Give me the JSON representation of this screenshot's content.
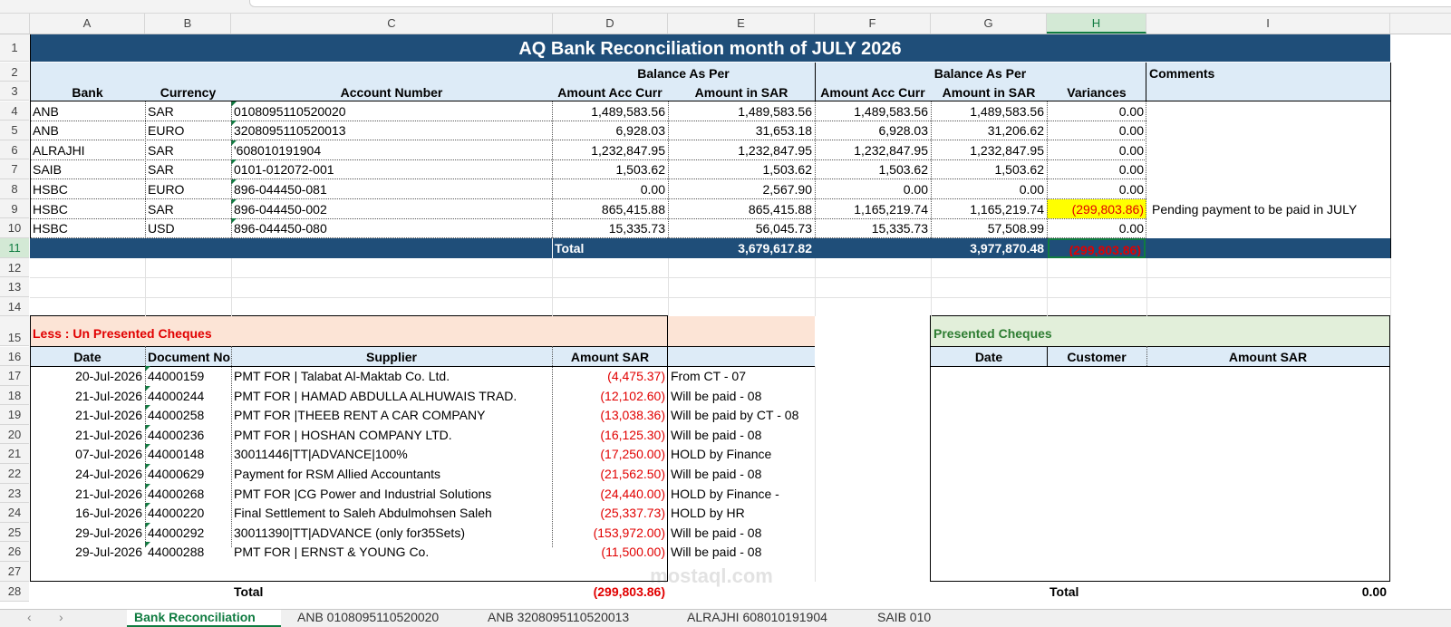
{
  "columns": [
    "A",
    "B",
    "C",
    "D",
    "E",
    "F",
    "G",
    "H",
    "I"
  ],
  "selected_column": "H",
  "rows": [
    "1",
    "2",
    "3",
    "4",
    "5",
    "6",
    "7",
    "8",
    "9",
    "10",
    "11",
    "12",
    "13",
    "14",
    "15",
    "16",
    "17",
    "18",
    "19",
    "20",
    "21",
    "22",
    "23",
    "24",
    "25",
    "26",
    "27",
    "28"
  ],
  "selected_row": "11",
  "title": "AQ Bank Reconciliation month of JULY 2026",
  "headers": {
    "balance_as_per_1": "Balance As Per",
    "balance_as_per_2": "Balance As Per",
    "comments": "Comments",
    "bank": "Bank",
    "currency": "Currency",
    "account_number": "Account Number",
    "amount_acc_curr_1": "Amount Acc Curr",
    "amount_in_sar_1": "Amount in SAR",
    "amount_acc_curr_2": "Amount Acc Curr",
    "amount_in_sar_2": "Amount in SAR",
    "variances": "Variances"
  },
  "bank_rows": [
    {
      "bank": "ANB",
      "currency": "SAR",
      "account": "0108095110520020",
      "d": "1,489,583.56",
      "e": "1,489,583.56",
      "f": "1,489,583.56",
      "g": "1,489,583.56",
      "h": "0.00",
      "comment": ""
    },
    {
      "bank": "ANB",
      "currency": "EURO",
      "account": "3208095110520013",
      "d": "6,928.03",
      "e": "31,653.18",
      "f": "6,928.03",
      "g": "31,206.62",
      "h": "0.00",
      "comment": ""
    },
    {
      "bank": "ALRAJHI",
      "currency": "SAR",
      "account": "'608010191904",
      "d": "1,232,847.95",
      "e": "1,232,847.95",
      "f": "1,232,847.95",
      "g": "1,232,847.95",
      "h": "0.00",
      "comment": ""
    },
    {
      "bank": "SAIB",
      "currency": "SAR",
      "account": "0101-012072-001",
      "d": "1,503.62",
      "e": "1,503.62",
      "f": "1,503.62",
      "g": "1,503.62",
      "h": "0.00",
      "comment": ""
    },
    {
      "bank": "HSBC",
      "currency": "EURO",
      "account": "896-044450-081",
      "d": "0.00",
      "e": "2,567.90",
      "f": "0.00",
      "g": "0.00",
      "h": "0.00",
      "comment": ""
    },
    {
      "bank": "HSBC",
      "currency": "SAR",
      "account": "896-044450-002",
      "d": "865,415.88",
      "e": "865,415.88",
      "f": "1,165,219.74",
      "g": "1,165,219.74",
      "h": "(299,803.86)",
      "comment": "Pending payment to be paid in JULY"
    },
    {
      "bank": "HSBC",
      "currency": "USD",
      "account": "896-044450-080",
      "d": "15,335.73",
      "e": "56,045.73",
      "f": "15,335.73",
      "g": "57,508.99",
      "h": "0.00",
      "comment": ""
    }
  ],
  "total_row": {
    "label": "Total",
    "e": "3,679,617.82",
    "g": "3,977,870.48",
    "h": "(299,803.86)"
  },
  "unpresented": {
    "title": "Less : Un Presented Cheques",
    "headers": {
      "date": "Date",
      "doc": "Document No",
      "supplier": "Supplier",
      "amount": "Amount SAR"
    },
    "rows": [
      {
        "date": "20-Jul-2026",
        "doc": "44000159",
        "supplier": "PMT FOR | Talabat Al-Maktab Co. Ltd.",
        "amount": "(4,475.37)",
        "note": "From CT - 07"
      },
      {
        "date": "21-Jul-2026",
        "doc": "44000244",
        "supplier": "PMT FOR |  HAMAD ABDULLA ALHUWAIS TRAD.",
        "amount": "(12,102.60)",
        "note": "Will be paid - 08"
      },
      {
        "date": "21-Jul-2026",
        "doc": "44000258",
        "supplier": "PMT FOR |THEEB RENT A CAR COMPANY",
        "amount": "(13,038.36)",
        "note": "Will be paid by CT - 08"
      },
      {
        "date": "21-Jul-2026",
        "doc": "44000236",
        "supplier": "PMT FOR | HOSHAN COMPANY LTD.",
        "amount": "(16,125.30)",
        "note": "Will be paid - 08"
      },
      {
        "date": "07-Jul-2026",
        "doc": "44000148",
        "supplier": "30011446|TT|ADVANCE|100%",
        "amount": "(17,250.00)",
        "note": "HOLD by Finance"
      },
      {
        "date": "24-Jul-2026",
        "doc": "44000629",
        "supplier": "Payment for RSM Allied Accountants",
        "amount": "(21,562.50)",
        "note": "Will be paid - 08"
      },
      {
        "date": "21-Jul-2026",
        "doc": "44000268",
        "supplier": "PMT FOR |CG Power and Industrial Solutions",
        "amount": "(24,440.00)",
        "note": "HOLD by Finance -"
      },
      {
        "date": "16-Jul-2026",
        "doc": "44000220",
        "supplier": "Final Settlement to Saleh Abdulmohsen Saleh",
        "amount": "(25,337.73)",
        "note": "HOLD by HR"
      },
      {
        "date": "29-Jul-2026",
        "doc": "44000292",
        "supplier": "30011390|TT|ADVANCE (only for35Sets)",
        "amount": "(153,972.00)",
        "note": "Will be paid - 08"
      },
      {
        "date": "29-Jul-2026",
        "doc": "44000288",
        "supplier": "PMT FOR |  ERNST & YOUNG Co.",
        "amount": "(11,500.00)",
        "note": "Will be paid - 08"
      }
    ],
    "total_label": "Total",
    "total": "(299,803.86)"
  },
  "presented": {
    "title": "Presented Cheques",
    "headers": {
      "date": "Date",
      "customer": "Customer",
      "amount": "Amount SAR"
    },
    "total_label": "Total",
    "total": "0.00"
  },
  "watermark": "mostaql.com",
  "sheet_tabs": [
    "Bank Reconciliation",
    "ANB 0108095110520020",
    "ANB 3208095110520013",
    "ALRAJHI 608010191904",
    "SAIB 010"
  ],
  "colors": {
    "navy": "#1f4e79",
    "light_blue": "#ddebf7",
    "peach": "#fce4d6",
    "green_header": "#e2efda",
    "highlight": "#ffff00",
    "negative": "#e10000",
    "excel_green": "#107c41"
  }
}
